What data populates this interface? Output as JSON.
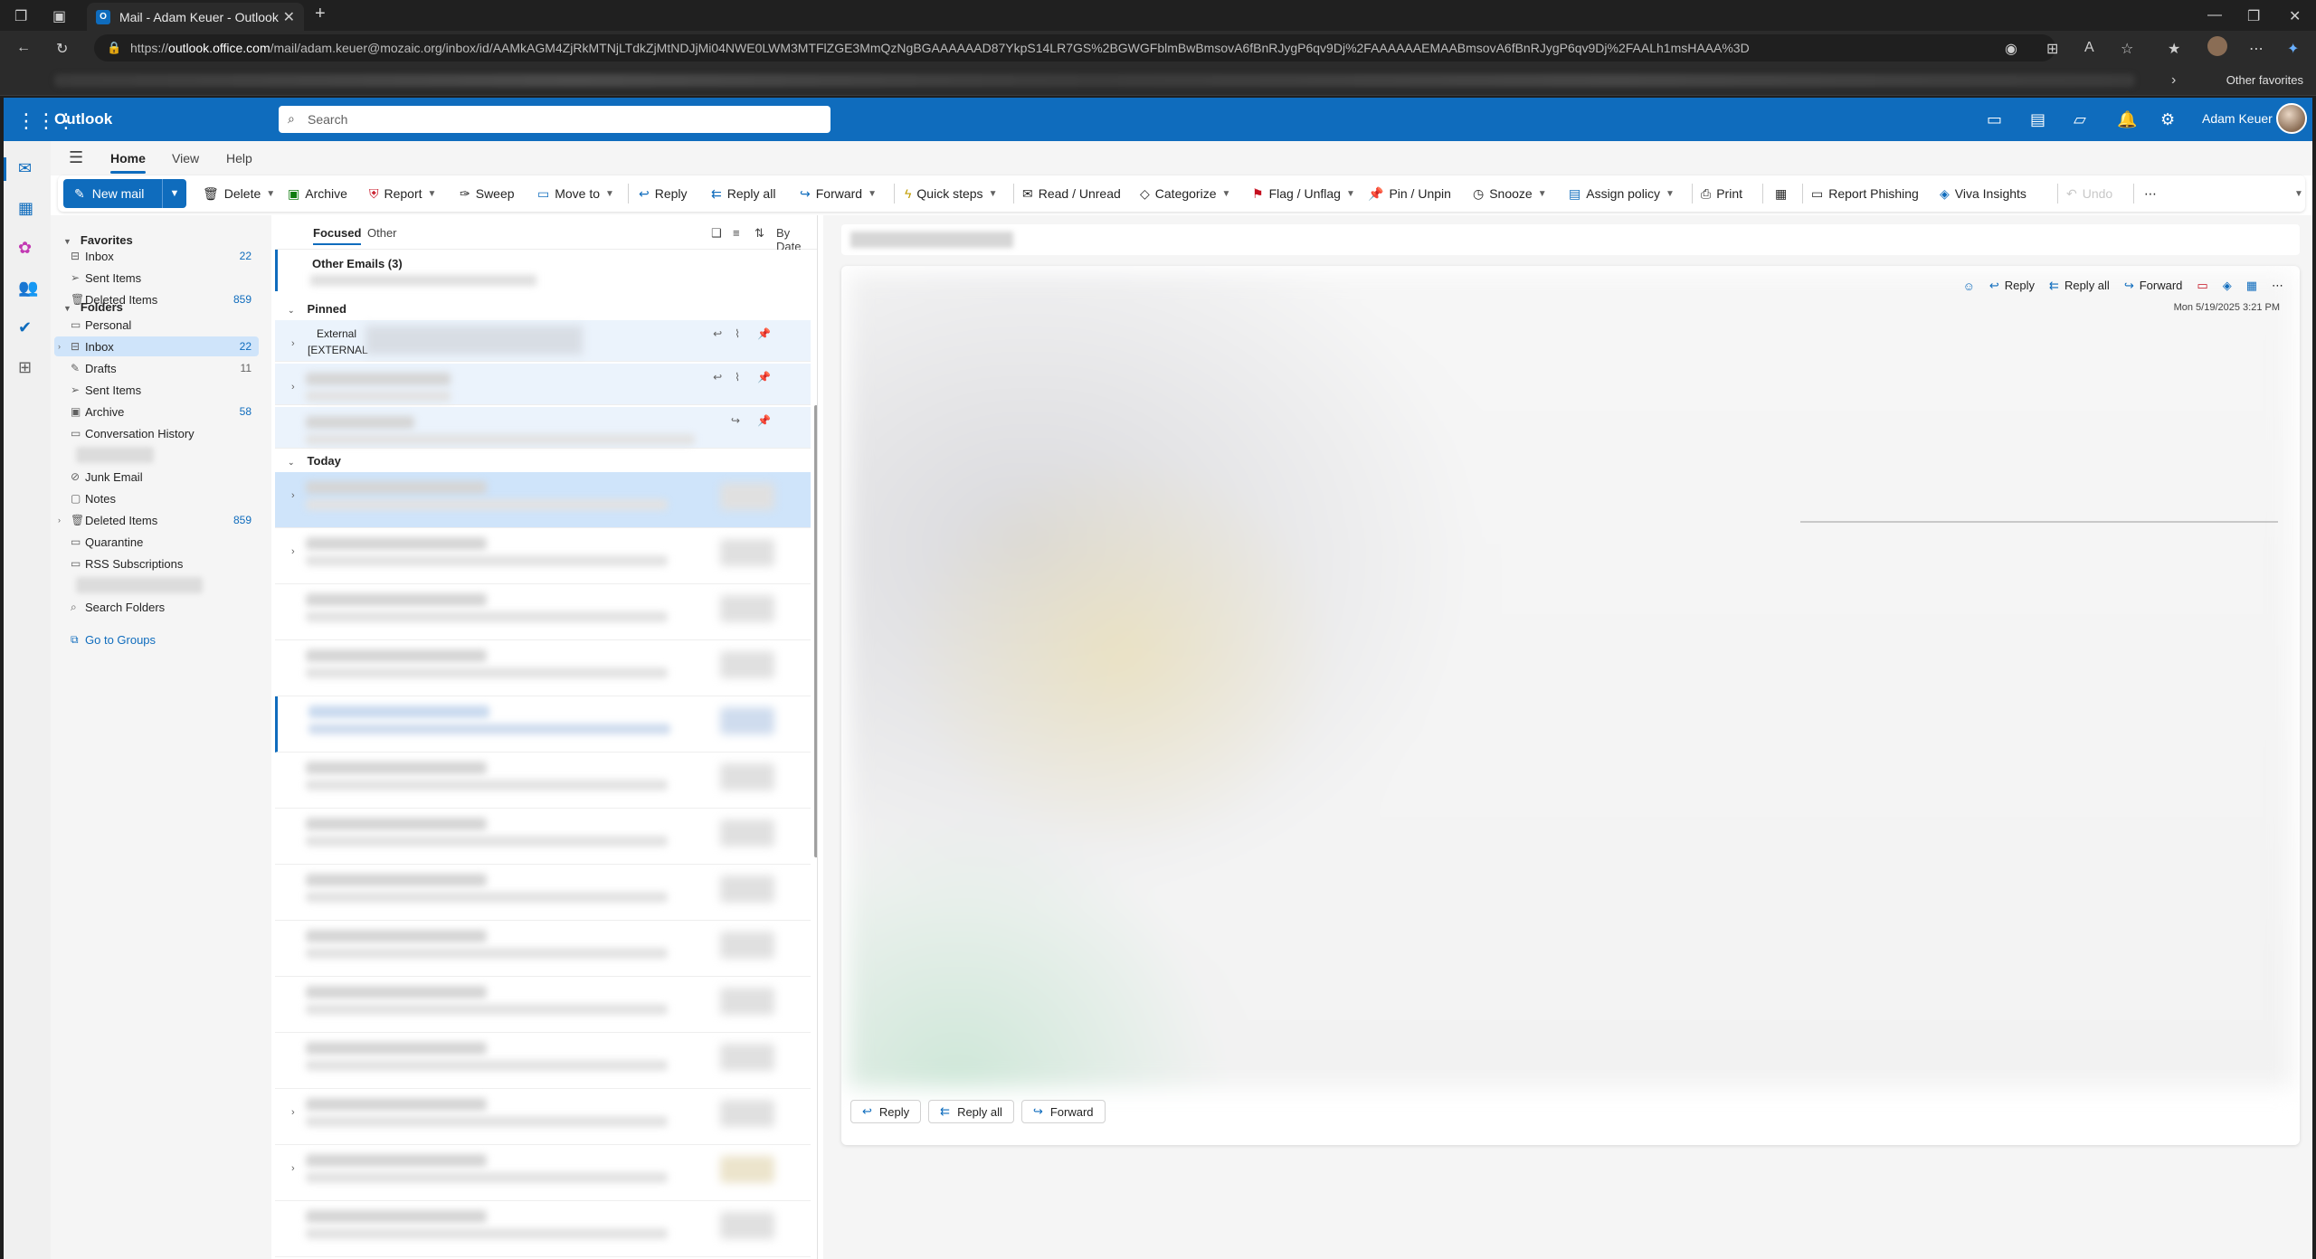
{
  "browser": {
    "tab_title": "Mail - Adam Keuer - Outlook",
    "url_prefix": "https://",
    "url_host": "outlook.office.com",
    "url_path": "/mail/adam.keuer@mozaic.org/inbox/id/AAMkAGM4ZjRkMTNjLTdkZjMtNDJjMi04NWE0LWM3MTFlZGE3MmQzNgBGAAAAAAD87YkpS14LR7GS%2BGWGFblmBwBmsovA6fBnRJygP6qv9Dj%2FAAAAAAEMAABmsovA6fBnRJygP6qv9Dj%2FAALh1msHAAA%3D",
    "other_favorites": "Other favorites"
  },
  "suite": {
    "brand": "Outlook",
    "search_placeholder": "Search",
    "user_name": "Adam Keuer"
  },
  "ribbon_tabs": [
    "Home",
    "View",
    "Help"
  ],
  "ribbon": {
    "new_mail": "New mail",
    "delete": "Delete",
    "archive": "Archive",
    "report": "Report",
    "sweep": "Sweep",
    "move_to": "Move to",
    "reply": "Reply",
    "reply_all": "Reply all",
    "forward": "Forward",
    "quick_steps": "Quick steps",
    "read_unread": "Read / Unread",
    "categorize": "Categorize",
    "flag_unflag": "Flag / Unflag",
    "pin_unpin": "Pin / Unpin",
    "snooze": "Snooze",
    "assign_policy": "Assign policy",
    "print": "Print",
    "report_phishing": "Report Phishing",
    "viva_insights": "Viva Insights",
    "undo": "Undo"
  },
  "favorites": {
    "header": "Favorites",
    "items": [
      {
        "label": "Inbox",
        "count": "22"
      },
      {
        "label": "Sent Items",
        "count": ""
      },
      {
        "label": "Deleted Items",
        "count": "859"
      }
    ]
  },
  "folders": {
    "header": "Folders",
    "items": [
      {
        "label": "Personal",
        "count": ""
      },
      {
        "label": "Inbox",
        "count": "22"
      },
      {
        "label": "Drafts",
        "count": "11"
      },
      {
        "label": "Sent Items",
        "count": ""
      },
      {
        "label": "Archive",
        "count": "58"
      },
      {
        "label": "Conversation History",
        "count": ""
      },
      {
        "label": "Junk Email",
        "count": ""
      },
      {
        "label": "Notes",
        "count": ""
      },
      {
        "label": "Deleted Items",
        "count": "859"
      },
      {
        "label": "Quarantine",
        "count": ""
      },
      {
        "label": "RSS Subscriptions",
        "count": ""
      },
      {
        "label": "Search Folders",
        "count": ""
      }
    ],
    "go_to_groups": "Go to Groups"
  },
  "message_list": {
    "tab_focused": "Focused",
    "tab_other": "Other",
    "sort_label": "By Date",
    "other_emails": "Other Emails (3)",
    "group_pinned": "Pinned",
    "group_today": "Today",
    "pinned_first_sender": "External",
    "pinned_first_subject": "[EXTERNAL"
  },
  "reading": {
    "reply": "Reply",
    "reply_all": "Reply all",
    "forward": "Forward",
    "date": "Mon 5/19/2025 3:21 PM"
  }
}
